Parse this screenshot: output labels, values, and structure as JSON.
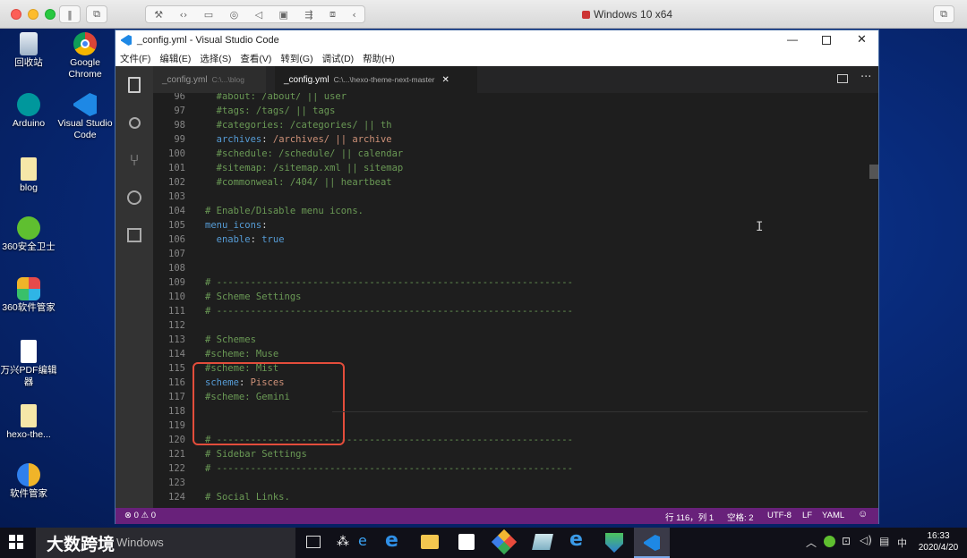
{
  "host": {
    "title": "Windows 10 x64"
  },
  "desktop_icons": [
    {
      "label": "回收站",
      "icon": "recycle-bin-icon"
    },
    {
      "label": "Google Chrome",
      "icon": "chrome-icon"
    },
    {
      "label": "Arduino",
      "icon": "arduino-icon"
    },
    {
      "label": "Visual Studio Code",
      "icon": "vscode-icon"
    },
    {
      "label": "blog",
      "icon": "folder-icon"
    },
    {
      "label": "360安全卫士",
      "icon": "360-safe-icon"
    },
    {
      "label": "360软件管家",
      "icon": "360-software-icon"
    },
    {
      "label": "万兴PDF编辑器",
      "icon": "pdf-icon"
    },
    {
      "label": "hexo-the...",
      "icon": "folder-icon"
    },
    {
      "label": "软件管家",
      "icon": "software-manager-icon"
    }
  ],
  "vscode": {
    "title": "_config.yml - Visual Studio Code",
    "menu": [
      "文件(F)",
      "编辑(E)",
      "选择(S)",
      "查看(V)",
      "转到(G)",
      "调试(D)",
      "帮助(H)"
    ],
    "tabs": [
      {
        "name": "_config.yml",
        "path": "C:\\...\\blog",
        "active": false
      },
      {
        "name": "_config.yml",
        "path": "C:\\...\\hexo-theme-next-master",
        "active": true
      }
    ],
    "status": {
      "errors": "0",
      "warnings": "0",
      "position": "行 116，列 1",
      "spaces": "空格: 2",
      "encoding": "UTF-8",
      "eol": "LF",
      "language": "YAML"
    }
  },
  "code_lines": [
    {
      "n": "96",
      "t": "  #about: /about/ || user",
      "c": "cmt"
    },
    {
      "n": "97",
      "t": "  #tags: /tags/ || tags",
      "c": "cmt"
    },
    {
      "n": "98",
      "t": "  #categories: /categories/ || th",
      "c": "cmt"
    },
    {
      "n": "99",
      "k": "  archives",
      "v": " /archives/ || archive",
      "c": "kv"
    },
    {
      "n": "100",
      "t": "  #schedule: /schedule/ || calendar",
      "c": "cmt"
    },
    {
      "n": "101",
      "t": "  #sitemap: /sitemap.xml || sitemap",
      "c": "cmt"
    },
    {
      "n": "102",
      "t": "  #commonweal: /404/ || heartbeat",
      "c": "cmt"
    },
    {
      "n": "103",
      "t": "",
      "c": "cmt"
    },
    {
      "n": "104",
      "t": "# Enable/Disable menu icons.",
      "c": "cmt"
    },
    {
      "n": "105",
      "k": "menu_icons",
      "v": "",
      "c": "kv"
    },
    {
      "n": "106",
      "k": "  enable",
      "v": " true",
      "c": "kb"
    },
    {
      "n": "107",
      "t": "",
      "c": "cmt"
    },
    {
      "n": "108",
      "t": "",
      "c": "cmt"
    },
    {
      "n": "109",
      "t": "# ---------------------------------------------------------------",
      "c": "cmt"
    },
    {
      "n": "110",
      "t": "# Scheme Settings",
      "c": "cmt"
    },
    {
      "n": "111",
      "t": "# ---------------------------------------------------------------",
      "c": "cmt"
    },
    {
      "n": "112",
      "t": "",
      "c": "cmt"
    },
    {
      "n": "113",
      "t": "# Schemes",
      "c": "cmt"
    },
    {
      "n": "114",
      "t": "#scheme: Muse",
      "c": "cmt"
    },
    {
      "n": "115",
      "t": "#scheme: Mist",
      "c": "cmt"
    },
    {
      "n": "116",
      "k": "scheme",
      "v": " Pisces",
      "c": "kv"
    },
    {
      "n": "117",
      "t": "#scheme: Gemini",
      "c": "cmt"
    },
    {
      "n": "118",
      "t": "",
      "c": "cmt"
    },
    {
      "n": "119",
      "t": "",
      "c": "cmt"
    },
    {
      "n": "120",
      "t": "# ---------------------------------------------------------------",
      "c": "cmt"
    },
    {
      "n": "121",
      "t": "# Sidebar Settings",
      "c": "cmt"
    },
    {
      "n": "122",
      "t": "# ---------------------------------------------------------------",
      "c": "cmt"
    },
    {
      "n": "123",
      "t": "",
      "c": "cmt"
    },
    {
      "n": "124",
      "t": "# Social Links.",
      "c": "cmt"
    }
  ],
  "taskbar": {
    "search_text": "Windows",
    "time": "16:33",
    "date": "2020/4/20",
    "ime": "中",
    "watermark": "大数跨境"
  }
}
